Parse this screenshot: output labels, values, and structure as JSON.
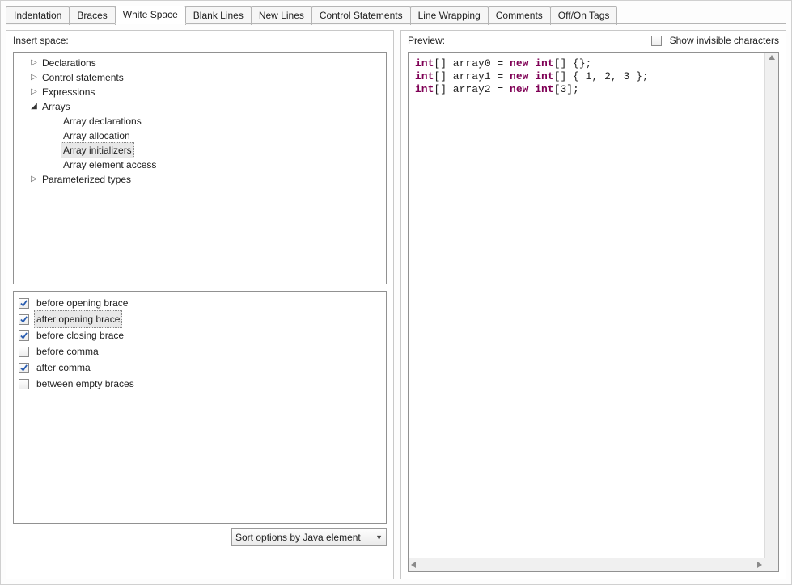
{
  "tabs": [
    "Indentation",
    "Braces",
    "White Space",
    "Blank Lines",
    "New Lines",
    "Control Statements",
    "Line Wrapping",
    "Comments",
    "Off/On Tags"
  ],
  "active_tab": 2,
  "left": {
    "title": "Insert space:",
    "tree": [
      {
        "label": "Declarations",
        "level": 1,
        "expander": "collapsed"
      },
      {
        "label": "Control statements",
        "level": 1,
        "expander": "collapsed"
      },
      {
        "label": "Expressions",
        "level": 1,
        "expander": "collapsed"
      },
      {
        "label": "Arrays",
        "level": 1,
        "expander": "expanded"
      },
      {
        "label": "Array declarations",
        "level": 2,
        "expander": "none"
      },
      {
        "label": "Array allocation",
        "level": 2,
        "expander": "none"
      },
      {
        "label": "Array initializers",
        "level": 2,
        "expander": "none",
        "selected": true
      },
      {
        "label": "Array element access",
        "level": 2,
        "expander": "none"
      },
      {
        "label": "Parameterized types",
        "level": 1,
        "expander": "collapsed"
      }
    ],
    "options": [
      {
        "label": "before opening brace",
        "checked": true
      },
      {
        "label": "after opening brace",
        "checked": true,
        "selected": true
      },
      {
        "label": "before closing brace",
        "checked": true
      },
      {
        "label": "before comma",
        "checked": false
      },
      {
        "label": "after comma",
        "checked": true
      },
      {
        "label": "between empty braces",
        "checked": false
      }
    ],
    "sort_label": "Sort options by Java element"
  },
  "right": {
    "title": "Preview:",
    "show_invisible_label": "Show invisible characters",
    "show_invisible_checked": false,
    "code_lines": [
      [
        {
          "t": "int",
          "c": "kw"
        },
        {
          "t": "[] array0 = "
        },
        {
          "t": "new",
          "c": "kw"
        },
        {
          "t": " "
        },
        {
          "t": "int",
          "c": "kw"
        },
        {
          "t": "[] {};"
        }
      ],
      [
        {
          "t": "int",
          "c": "kw"
        },
        {
          "t": "[] array1 = "
        },
        {
          "t": "new",
          "c": "kw"
        },
        {
          "t": " "
        },
        {
          "t": "int",
          "c": "kw"
        },
        {
          "t": "[] { 1, 2, 3 };"
        }
      ],
      [
        {
          "t": "int",
          "c": "kw"
        },
        {
          "t": "[] array2 = "
        },
        {
          "t": "new",
          "c": "kw"
        },
        {
          "t": " "
        },
        {
          "t": "int",
          "c": "kw"
        },
        {
          "t": "[3];"
        }
      ]
    ]
  }
}
